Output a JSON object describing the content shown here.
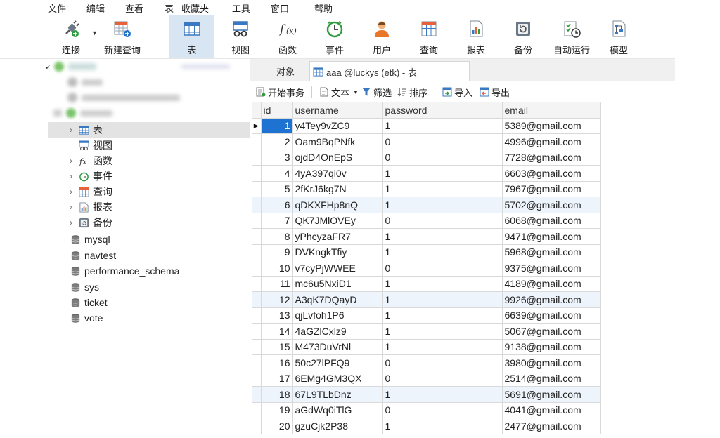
{
  "menu": [
    "文件",
    "编辑",
    "查看",
    "表",
    "收藏夹",
    "工具",
    "窗口",
    "帮助"
  ],
  "toolbar": {
    "connect": "连接",
    "new_query": "新建查询",
    "table": "表",
    "view": "视图",
    "function": "函数",
    "event": "事件",
    "user": "用户",
    "query": "查询",
    "report": "报表",
    "backup": "备份",
    "automation": "自动运行",
    "model": "模型"
  },
  "tree": {
    "children": [
      "表",
      "视图",
      "函数",
      "事件",
      "查询",
      "报表",
      "备份"
    ],
    "databases": [
      "mysql",
      "navtest",
      "performance_schema",
      "sys",
      "ticket",
      "vote"
    ]
  },
  "tabs": {
    "objects": "对象",
    "active": "aaa @luckys (etk) - 表"
  },
  "objbar": {
    "begin_tx": "开始事务",
    "text": "文本",
    "filter": "筛选",
    "sort": "排序",
    "import": "导入",
    "export": "导出"
  },
  "grid": {
    "columns": [
      "id",
      "username",
      "password",
      "email"
    ],
    "rows": [
      [
        "1",
        "y4Tey9vZC9",
        "1",
        "5389@gmail.com"
      ],
      [
        "2",
        "Oam9BqPNfk",
        "0",
        "4996@gmail.com"
      ],
      [
        "3",
        "ojdD4OnEpS",
        "0",
        "7728@gmail.com"
      ],
      [
        "4",
        "4yA397qi0v",
        "1",
        "6603@gmail.com"
      ],
      [
        "5",
        "2fKrJ6kg7N",
        "1",
        "7967@gmail.com"
      ],
      [
        "6",
        "qDKXFHp8nQ",
        "1",
        "5702@gmail.com"
      ],
      [
        "7",
        "QK7JMlOVEy",
        "0",
        "6068@gmail.com"
      ],
      [
        "8",
        "yPhcyzaFR7",
        "1",
        "9471@gmail.com"
      ],
      [
        "9",
        "DVKngkTfiy",
        "1",
        "5968@gmail.com"
      ],
      [
        "10",
        "v7cyPjWWEE",
        "0",
        "9375@gmail.com"
      ],
      [
        "11",
        "mc6u5NxiD1",
        "1",
        "4189@gmail.com"
      ],
      [
        "12",
        "A3qK7DQayD",
        "1",
        "9926@gmail.com"
      ],
      [
        "13",
        "qjLvfoh1P6",
        "1",
        "6639@gmail.com"
      ],
      [
        "14",
        "4aGZlCxlz9",
        "1",
        "5067@gmail.com"
      ],
      [
        "15",
        "M473DuVrNl",
        "1",
        "9138@gmail.com"
      ],
      [
        "16",
        "50c27lPFQ9",
        "0",
        "3980@gmail.com"
      ],
      [
        "17",
        "6EMg4GM3QX",
        "0",
        "2514@gmail.com"
      ],
      [
        "18",
        "67L9TLbDnz",
        "1",
        "5691@gmail.com"
      ],
      [
        "19",
        "aGdWq0iTlG",
        "0",
        "4041@gmail.com"
      ],
      [
        "20",
        "gzuCjk2P38",
        "1",
        "2477@gmail.com"
      ]
    ]
  },
  "colors": {
    "selection": "#1e73d2",
    "toolbar_selected": "#d8e6f3",
    "alt_row": "#eef4fb"
  }
}
